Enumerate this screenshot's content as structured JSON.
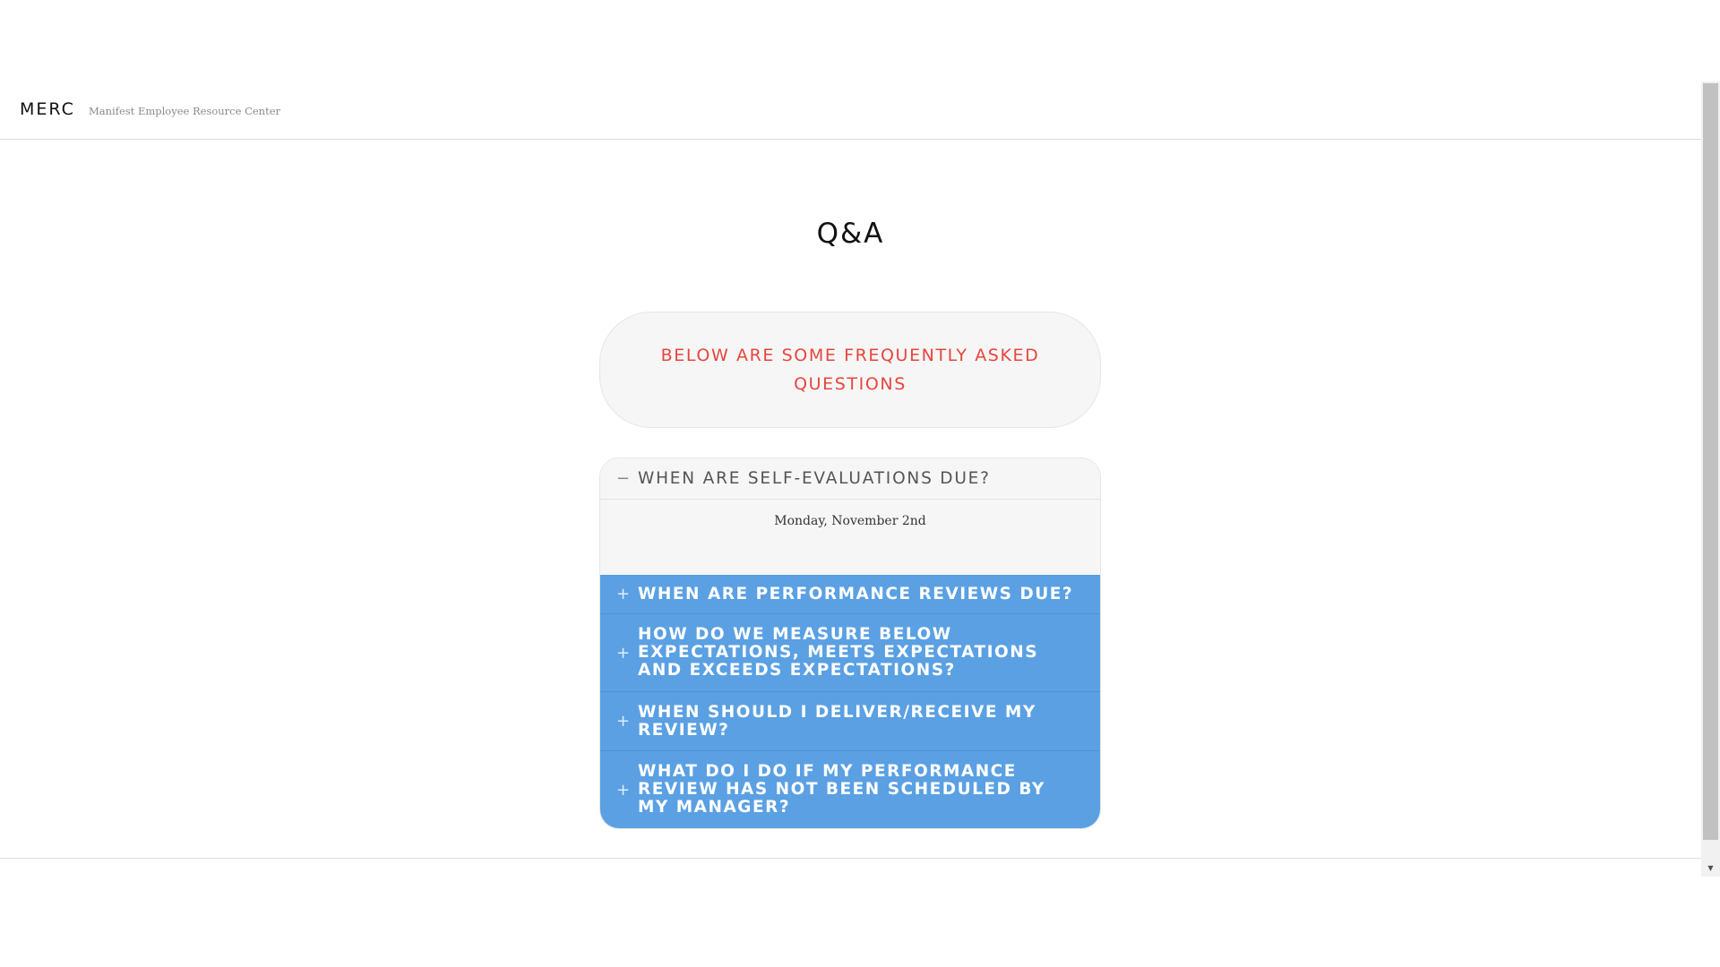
{
  "header": {
    "brand": "MERC",
    "tagline": "Manifest Employee Resource Center"
  },
  "page": {
    "title": "Q&A",
    "intro": "BELOW ARE SOME FREQUENTLY ASKED QUESTIONS"
  },
  "faq": {
    "items": [
      {
        "question": "WHEN ARE SELF-EVALUATIONS DUE?",
        "answer": "Monday, November 2nd",
        "icon": "−",
        "expanded": true
      },
      {
        "question": "WHEN ARE PERFORMANCE REVIEWS DUE?",
        "icon": "+",
        "expanded": false
      },
      {
        "question": "HOW DO WE MEASURE BELOW EXPECTATIONS, MEETS EXPECTATIONS AND EXCEEDS EXPECTATIONS?",
        "icon": "+",
        "expanded": false
      },
      {
        "question": "WHEN SHOULD I DELIVER/RECEIVE MY REVIEW?",
        "icon": "+",
        "expanded": false
      },
      {
        "question": "WHAT DO I DO IF MY PERFORMANCE REVIEW HAS NOT BEEN SCHEDULED BY MY MANAGER?",
        "icon": "+",
        "expanded": false
      }
    ]
  },
  "colors": {
    "accent_blue": "#5aa0e3",
    "intro_red": "#e8453c",
    "panel_gray": "#f6f6f6"
  },
  "icons": {
    "collapse": "minus-icon",
    "expand": "plus-icon",
    "scroll_down": "chevron-down-icon"
  }
}
